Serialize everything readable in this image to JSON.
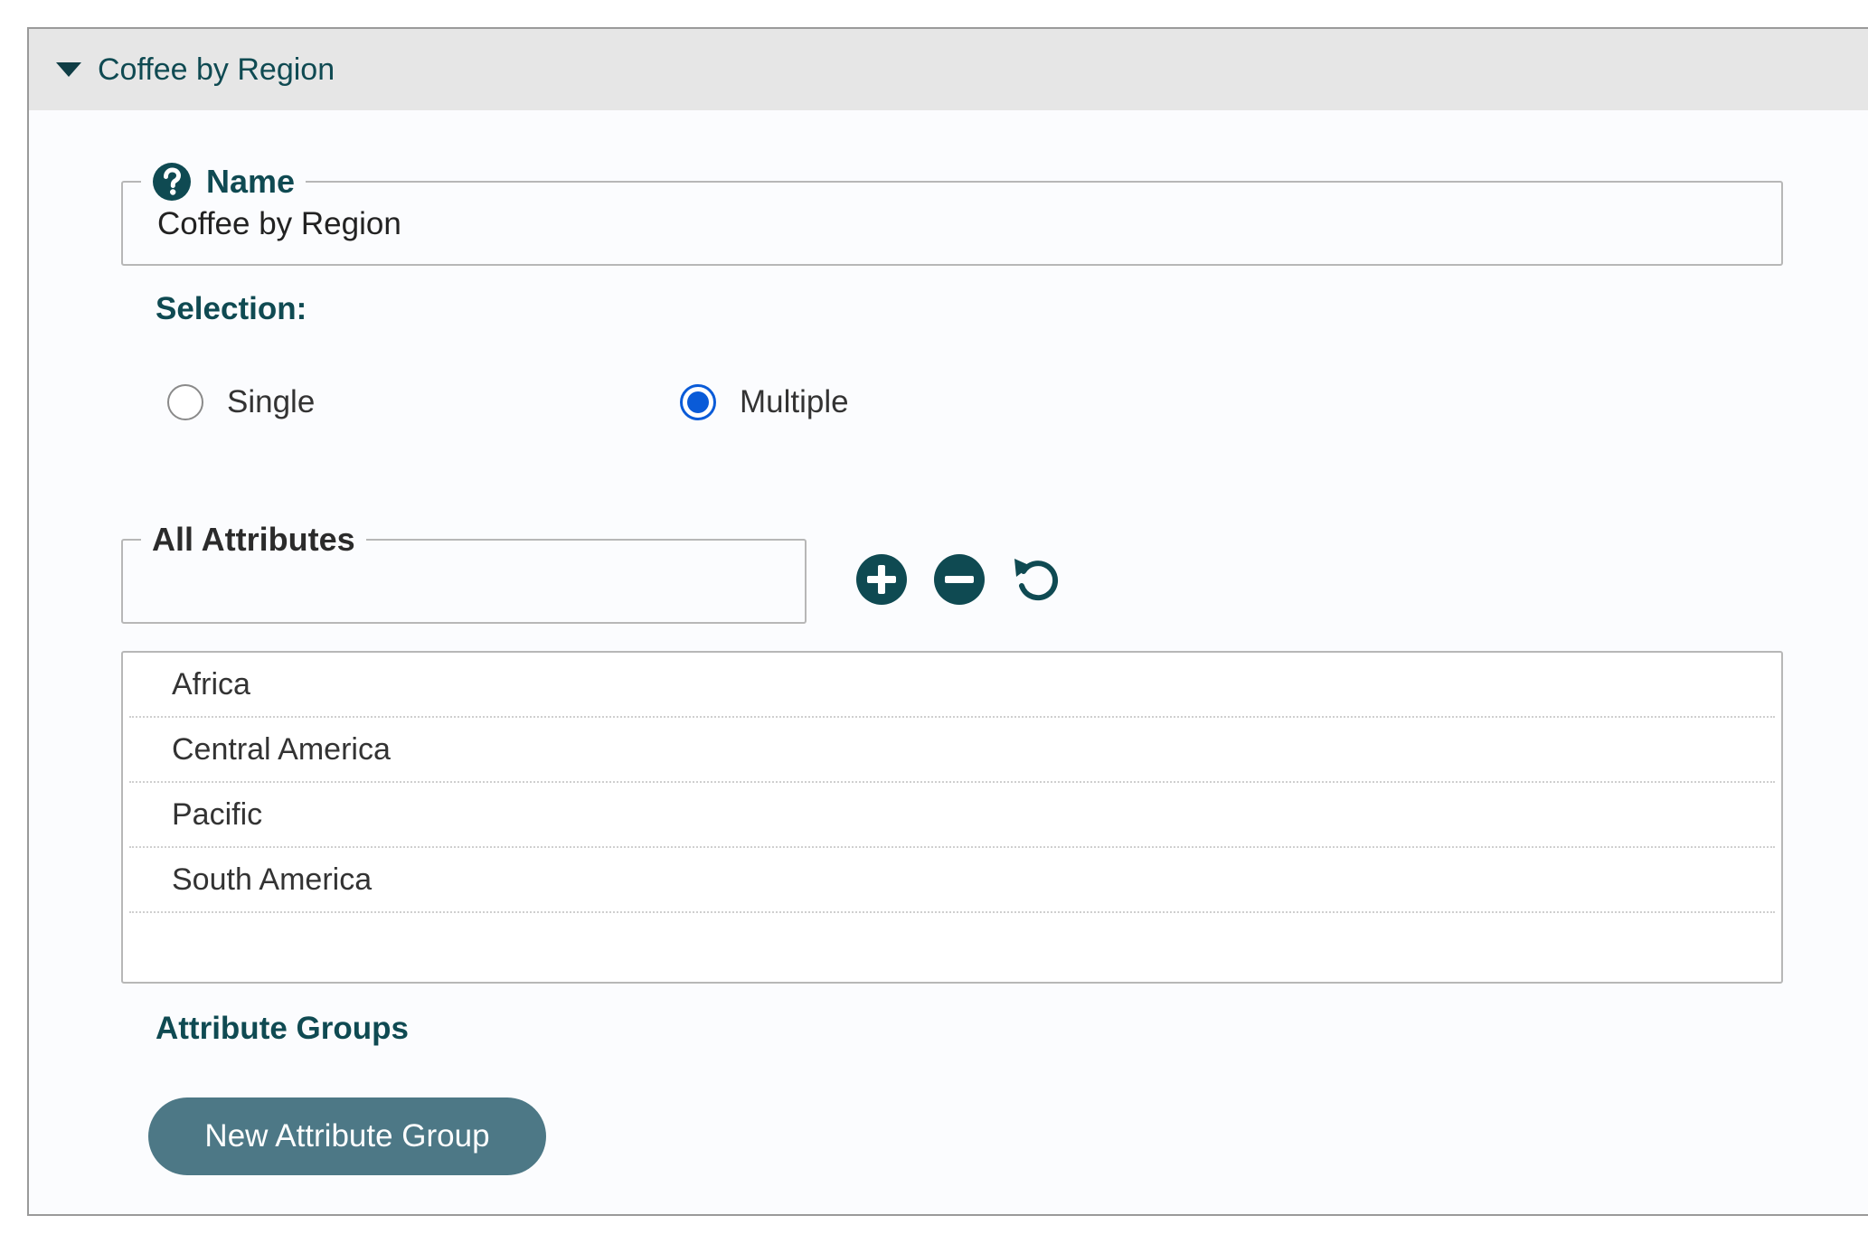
{
  "panel": {
    "title": "Coffee by Region"
  },
  "name_field": {
    "legend": "Name",
    "value": "Coffee by Region"
  },
  "selection": {
    "label": "Selection:",
    "options": [
      {
        "label": "Single",
        "checked": false
      },
      {
        "label": "Multiple",
        "checked": true
      }
    ]
  },
  "attributes": {
    "legend": "All Attributes",
    "filter_value": "",
    "items": [
      "Africa",
      "Central America",
      "Pacific",
      "South America"
    ]
  },
  "groups": {
    "label": "Attribute Groups",
    "new_button_label": "New Attribute Group"
  },
  "icons": {
    "help": "question-circle-icon",
    "add": "plus-circle-icon",
    "remove": "minus-circle-icon",
    "reset": "undo-icon",
    "collapse": "caret-down-icon"
  },
  "colors": {
    "accent": "#0f4a52",
    "radio_selected": "#0a5bd8",
    "button_bg": "#4d7886",
    "header_bg": "#e6e6e6"
  }
}
